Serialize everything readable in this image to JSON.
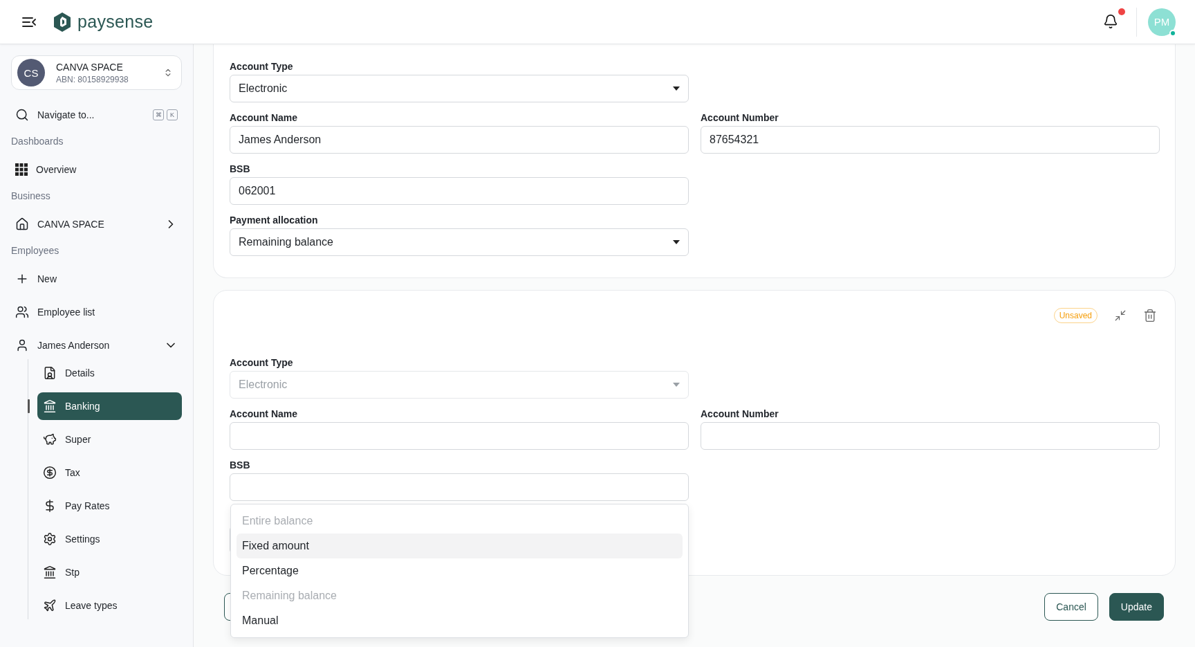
{
  "header": {
    "logo": "paysense",
    "notifications": {
      "unread": true
    },
    "avatar": {
      "initials": "PM",
      "online": true
    }
  },
  "sidebar": {
    "org": {
      "initials": "CS",
      "name": "CANVA SPACE",
      "abn": "ABN: 80158929938"
    },
    "search": {
      "label": "Navigate to...",
      "keys": [
        "⌘",
        "K"
      ]
    },
    "sections": [
      {
        "title": "Dashboards",
        "items": [
          {
            "label": "Overview",
            "selected": false
          }
        ]
      },
      {
        "title": "Business",
        "items": [
          {
            "label": "CANVA SPACE",
            "selected": false,
            "expanded": false
          }
        ]
      },
      {
        "title": "Employees",
        "items": [
          {
            "label": "New",
            "selected": false
          },
          {
            "label": "Employee list",
            "selected": false
          },
          {
            "label": "James Anderson",
            "selected": false,
            "expanded": true,
            "children": [
              {
                "label": "Details",
                "selected": false
              },
              {
                "label": "Banking",
                "selected": true
              },
              {
                "label": "Super",
                "selected": false
              },
              {
                "label": "Tax",
                "selected": false
              },
              {
                "label": "Pay Rates",
                "selected": false
              },
              {
                "label": "Settings",
                "selected": false
              },
              {
                "label": "Stp",
                "selected": false
              },
              {
                "label": "Leave types",
                "selected": false
              }
            ]
          }
        ]
      }
    ]
  },
  "cards": [
    {
      "rows": [
        [
          {
            "label": "Account Type",
            "kind": "select",
            "value": "Electronic",
            "disabled": false
          }
        ],
        [
          {
            "label": "Account Name",
            "kind": "text",
            "value": "James Anderson",
            "disabled": false
          },
          {
            "label": "Account Number",
            "kind": "text",
            "value": "87654321",
            "disabled": false
          }
        ],
        [
          {
            "label": "BSB",
            "kind": "text",
            "value": "062001",
            "disabled": false
          }
        ],
        [
          {
            "label": "Payment allocation",
            "kind": "select",
            "value": "Remaining balance",
            "disabled": false
          }
        ]
      ]
    },
    {
      "badge": "Unsaved",
      "rows": [
        [
          {
            "label": "Account Type",
            "kind": "select",
            "value": "Electronic",
            "disabled": true
          }
        ],
        [
          {
            "label": "Account Name",
            "kind": "text",
            "disabled": false
          },
          {
            "label": "Account Number",
            "kind": "text",
            "disabled": false
          }
        ],
        [
          {
            "label": "BSB",
            "kind": "text",
            "disabled": false
          }
        ],
        [
          {
            "kind": "select",
            "disabled": false,
            "open": true,
            "options": [
              {
                "label": "Entire balance",
                "disabled": true,
                "highlighted": false
              },
              {
                "label": "Fixed amount",
                "disabled": false,
                "highlighted": true
              },
              {
                "label": "Percentage",
                "disabled": false,
                "highlighted": false
              },
              {
                "label": "Remaining balance",
                "disabled": true,
                "highlighted": false
              },
              {
                "label": "Manual",
                "disabled": false,
                "highlighted": false
              }
            ]
          }
        ]
      ]
    }
  ],
  "actions": [
    {
      "kind": "outline"
    },
    {
      "kind": "outline",
      "label": "Cancel"
    },
    {
      "kind": "primary",
      "label": "Update"
    }
  ]
}
